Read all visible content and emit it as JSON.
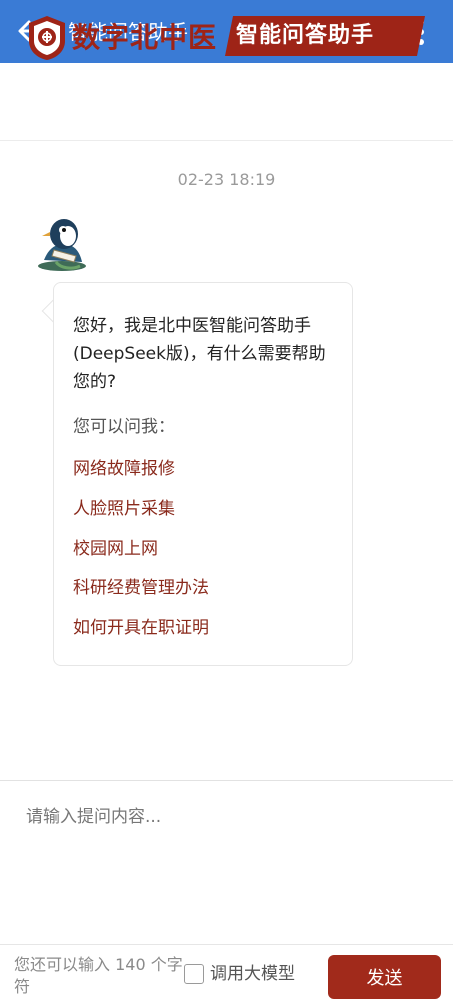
{
  "header": {
    "title": "智能问答助手",
    "back_icon": "arrow-left-icon",
    "more_icon": "more-vertical-icon",
    "bg_color": "#3a7bd5"
  },
  "banner": {
    "brand_text": "数字北中医",
    "ribbon_text": "智能问答助手",
    "brand_color": "#9e2417"
  },
  "chat": {
    "timestamp": "02-23 18:19",
    "greeting": "您好，我是北中医智能问答助手(DeepSeek版)，有什么需要帮助您的?",
    "ask_label": "您可以问我：",
    "suggestions": [
      "网络故障报修",
      "人脸照片采集",
      "校园网上网",
      "科研经费管理办法",
      "如何开具在职证明"
    ],
    "link_color": "#8a2a1c"
  },
  "input": {
    "placeholder": "请输入提问内容..."
  },
  "footer": {
    "remaining_text": "您还可以输入 140 个字符",
    "checkbox_label": "调用大模型",
    "send_label": "发送",
    "send_color": "#a12a1b"
  }
}
